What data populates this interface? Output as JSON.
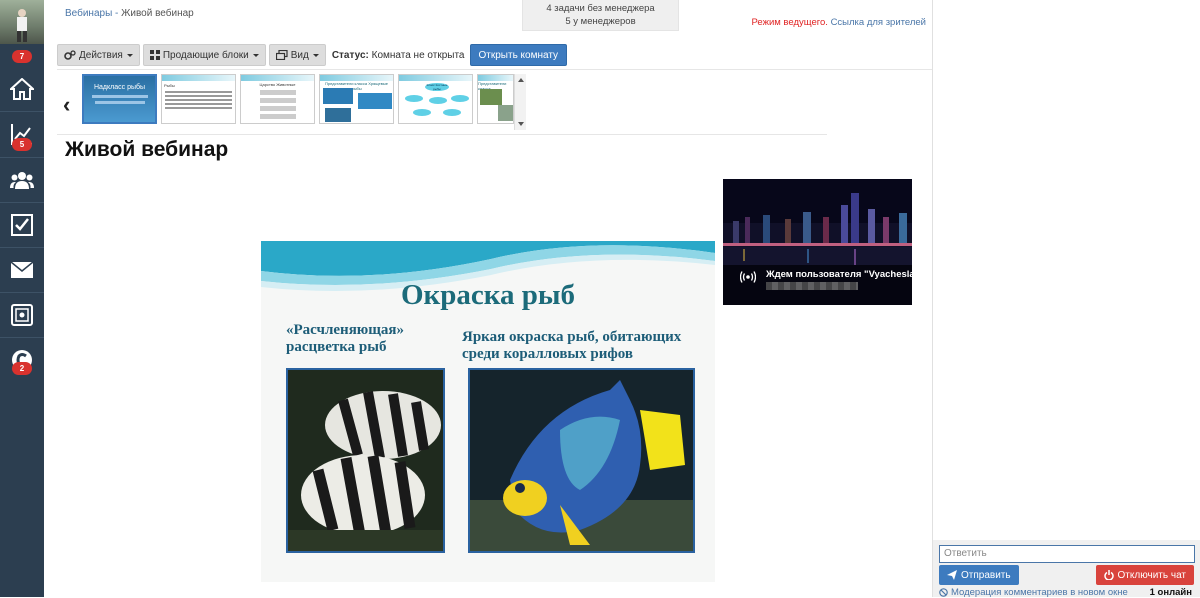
{
  "breadcrumb": {
    "root": "Вебинары",
    "separator": " - ",
    "current": "Живой вебинар"
  },
  "info_box": {
    "line1": "4 задачи без менеджера",
    "line2": "5 у менеджеров"
  },
  "mode": {
    "presenter": "Режим ведущего.",
    "viewers_link": "Ссылка для зрителей"
  },
  "sidebar": {
    "avatar_badge": "7",
    "items": [
      {
        "icon": "home-icon"
      },
      {
        "icon": "chart-icon",
        "badge": "5"
      },
      {
        "icon": "users-icon"
      },
      {
        "icon": "checkbox-icon"
      },
      {
        "icon": "mail-icon"
      },
      {
        "icon": "safe-icon"
      },
      {
        "icon": "c-logo-icon",
        "badge": "2"
      }
    ]
  },
  "toolbar": {
    "actions": "Действия",
    "blocks": "Продающие блоки",
    "view": "Вид",
    "status_label": "Статус:",
    "status_value": "Комната не открыта",
    "open_room": "Открыть комнату"
  },
  "slides_strip": [
    {
      "title": "Надкласс рыбы"
    },
    {
      "title": "Рыбы"
    },
    {
      "title": "Царство Животные"
    },
    {
      "title": "Представители класса Хрящевые рыбы"
    },
    {
      "title": "Класс Костные рыбы"
    },
    {
      "title": "Представители класса"
    }
  ],
  "page_title": "Живой вебинар",
  "video": {
    "waiting": "Ждем пользователя \"Vyacheslav"
  },
  "slide": {
    "title": "Окраска рыб",
    "caption_left_1": "«Расчленяющая»",
    "caption_left_2": "расцветка рыб",
    "caption_right_1": "Яркая окраска рыб, обитающих",
    "caption_right_2": "среди коралловых рифов"
  },
  "chat": {
    "reply_placeholder": "Ответить",
    "send": "Отправить",
    "disable_chat": "Отключить чат",
    "moderation": "Модерация комментариев в новом окне",
    "online": "1 онлайн"
  },
  "colors": {
    "sidebar": "#2c3e50",
    "badge": "#d9322e",
    "primary": "#3d7bbf",
    "danger": "#d9433c",
    "link": "#4a76a8",
    "slide_title": "#1c6b7a"
  }
}
